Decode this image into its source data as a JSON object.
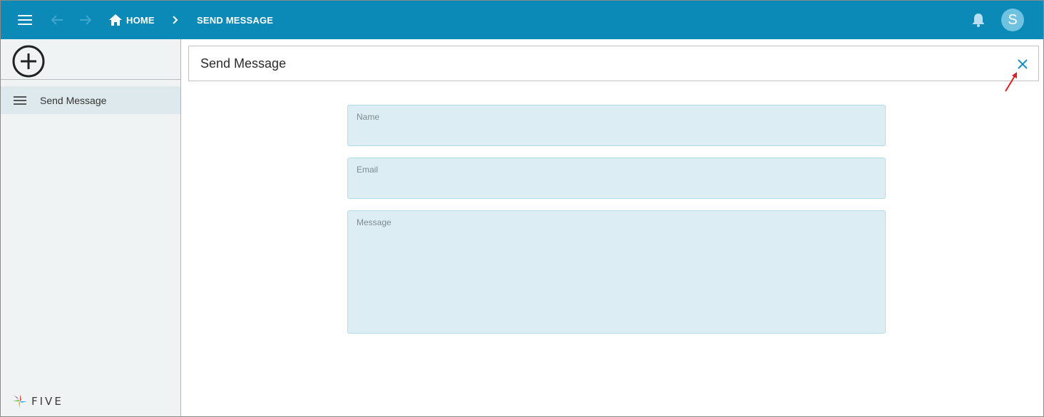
{
  "topbar": {
    "home_label": "HOME",
    "current_label": "SEND MESSAGE",
    "avatar_initial": "S",
    "bg_color": "#0b8ab8"
  },
  "sidebar": {
    "items": [
      {
        "label": "Send Message",
        "icon": "menu-lines-icon",
        "selected": true
      }
    ],
    "logo_text": "FIVE"
  },
  "content": {
    "title": "Send Message",
    "fields": {
      "name": {
        "label": "Name",
        "value": ""
      },
      "email": {
        "label": "Email",
        "value": ""
      },
      "message": {
        "label": "Message",
        "value": ""
      }
    }
  },
  "icons": {
    "menu": "hamburger-icon",
    "back": "arrow-left-icon",
    "forward": "arrow-right-icon",
    "home": "home-icon",
    "separator": "chevron-right-icon",
    "notifications": "bell-icon",
    "add": "plus-circle-icon",
    "close": "close-icon"
  },
  "colors": {
    "accent": "#0b8ab8",
    "field_bg": "#dceef4",
    "annotation_arrow": "#e02020"
  }
}
